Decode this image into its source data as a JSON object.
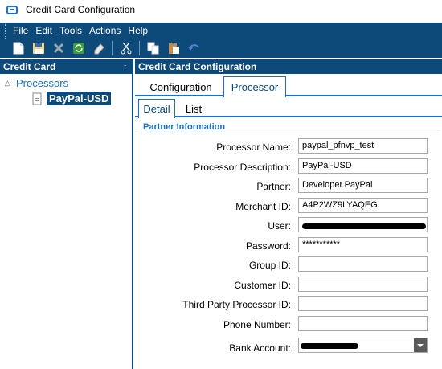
{
  "window": {
    "title": "Credit Card Configuration"
  },
  "menu": [
    "File",
    "Edit",
    "Tools",
    "Actions",
    "Help"
  ],
  "toolbar": {
    "icons": [
      "new-icon",
      "save-icon",
      "delete-icon",
      "refresh-icon",
      "clear-icon",
      "cut-icon",
      "copy-icon",
      "paste-icon",
      "undo-icon"
    ]
  },
  "left_pane": {
    "header": "Credit Card",
    "pin": "↑",
    "tree": {
      "root": "Processors",
      "toggle": "△",
      "child": "PayPal-USD"
    }
  },
  "right_pane": {
    "header": "Credit Card Configuration",
    "tabs": [
      "Configuration",
      "Processor"
    ],
    "active_tab": "Processor",
    "subtabs": [
      "Detail",
      "List"
    ],
    "active_subtab": "Detail",
    "section": "Partner Information",
    "fields": [
      {
        "label": "Processor Name:",
        "value": "paypal_pfnvp_test"
      },
      {
        "label": "Processor Description:",
        "value": "PayPal-USD"
      },
      {
        "label": "Partner:",
        "value": "Developer.PayPal"
      },
      {
        "label": "Merchant ID:",
        "value": "A4P2WZ9LYAQEG"
      },
      {
        "label": "User:",
        "value": ""
      },
      {
        "label": "Password:",
        "value": "***********"
      },
      {
        "label": "Group ID:",
        "value": ""
      },
      {
        "label": "Customer ID:",
        "value": ""
      },
      {
        "label": "Third Party Processor ID:",
        "value": ""
      },
      {
        "label": "Phone Number:",
        "value": ""
      },
      {
        "label": "Bank Account:",
        "value": ""
      }
    ]
  },
  "colors": {
    "accent": "#0d4a79",
    "tab_blue": "#1c6fc8"
  }
}
